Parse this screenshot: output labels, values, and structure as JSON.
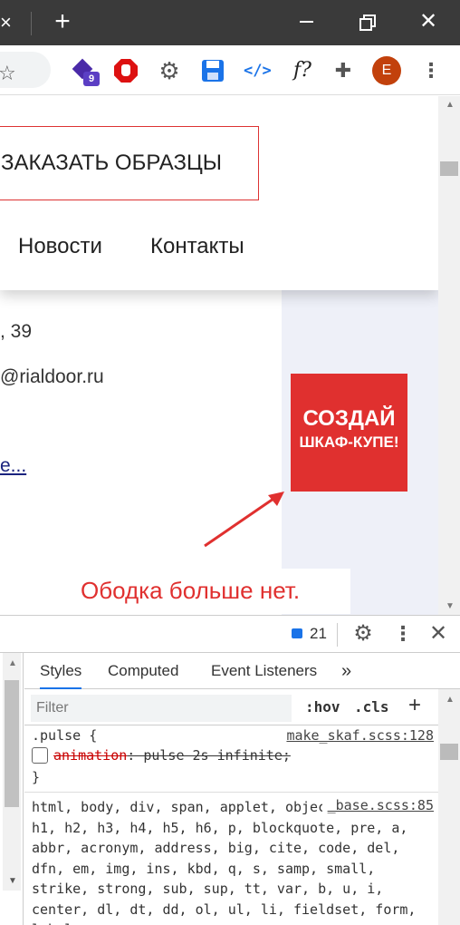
{
  "browser": {
    "newtab_symbol": "+",
    "extensions_badge": "9",
    "fx_label": "f?",
    "code_label": "</>",
    "avatar_letter": "E"
  },
  "page": {
    "order_button": "ЗАКАЗАТЬ ОБРАЗЦЫ",
    "nav": [
      "Новости",
      "Контакты"
    ],
    "address_fragment": ", 39",
    "email_fragment": "@rialdoor.ru",
    "more_link": "е...",
    "promo_line1": "СОЗДАЙ",
    "promo_line2": "ШКАФ-КУПЕ!",
    "annotation": "Ободка больше нет."
  },
  "devtools": {
    "messages_count": "21",
    "tabs": [
      "Styles",
      "Computed",
      "Event Listeners",
      "»"
    ],
    "filter_placeholder": "Filter",
    "hov": ":hov",
    "cls": ".cls",
    "plus": "+",
    "rule1": {
      "selector": ".pulse {",
      "source": "make_skaf.scss:128",
      "property": "animation",
      "value": ": pulse 2s infinite;",
      "close": "}"
    },
    "rule2": {
      "source": "_base.scss:85",
      "selector_text": "html, body, div, span, applet, object, iframe, h1, h2, h3, h4, h5, h6, p, blockquote, pre, a, abbr, acronym, address, big, cite, code, del, dfn, em, img, ins, kbd, q, s, samp, small, strike, strong, sub, sup, tt, var, b, u, i, center, dl, dt, dd, ol, ul, li, fieldset, form, label,"
    }
  },
  "colors": {
    "accent_red": "#e0302f",
    "devtools_blue": "#1a73e8",
    "titlebar": "#3a3a3a"
  }
}
